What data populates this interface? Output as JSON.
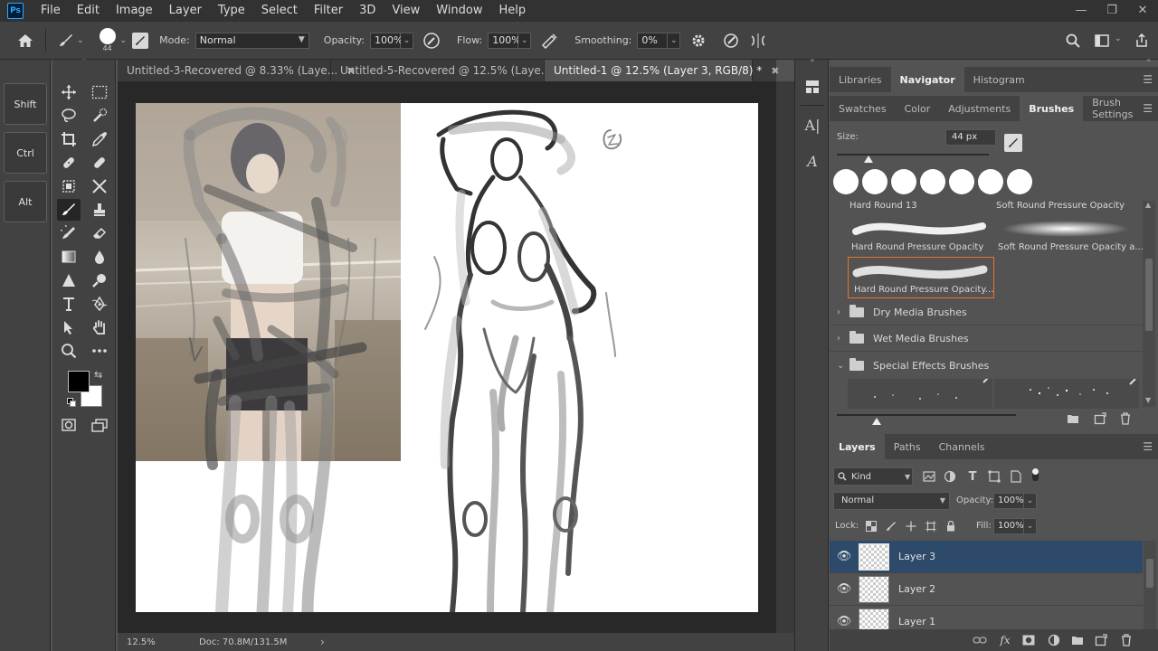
{
  "menu": {
    "logo": "Ps",
    "items": [
      "File",
      "Edit",
      "Image",
      "Layer",
      "Type",
      "Select",
      "Filter",
      "3D",
      "View",
      "Window",
      "Help"
    ]
  },
  "options": {
    "brush_size": "44",
    "mode_label": "Mode:",
    "mode_value": "Normal",
    "opacity_label": "Opacity:",
    "opacity_value": "100%",
    "flow_label": "Flow:",
    "flow_value": "100%",
    "smoothing_label": "Smoothing:",
    "smoothing_value": "0%"
  },
  "modifier_keys": [
    "Shift",
    "Ctrl",
    "Alt"
  ],
  "tabs": [
    {
      "label": "Untitled-3-Recovered @ 8.33% (Laye...",
      "active": false
    },
    {
      "label": "Untitled-5-Recovered @ 12.5% (Laye...",
      "active": false
    },
    {
      "label": "Untitled-1 @ 12.5% (Layer 3, RGB/8) *",
      "active": true
    }
  ],
  "status": {
    "zoom": "12.5%",
    "doc": "Doc: 70.8M/131.5M"
  },
  "panel_top_tabs": [
    "Libraries",
    "Navigator",
    "Histogram"
  ],
  "panel_mid_tabs": [
    "Swatches",
    "Color",
    "Adjustments",
    "Brushes",
    "Brush Settings"
  ],
  "brushes": {
    "size_label": "Size:",
    "size_value": "44 px",
    "presets": [
      {
        "name": "Hard Round 13"
      },
      {
        "name": "Soft Round Pressure Opacity"
      },
      {
        "name": "Hard Round Pressure Opacity"
      },
      {
        "name": "Soft Round Pressure Opacity a..."
      },
      {
        "name": "Hard Round Pressure Opacity..."
      }
    ],
    "folders": [
      "Dry Media Brushes",
      "Wet Media Brushes",
      "Special Effects Brushes"
    ]
  },
  "layers_tabs": [
    "Layers",
    "Paths",
    "Channels"
  ],
  "layers_panel": {
    "kind_label": "Kind",
    "blend_mode": "Normal",
    "opacity_label": "Opacity:",
    "opacity_value": "100%",
    "lock_label": "Lock:",
    "fill_label": "Fill:",
    "fill_value": "100%",
    "layers": [
      {
        "name": "Layer 3",
        "active": true
      },
      {
        "name": "Layer 2",
        "active": false
      },
      {
        "name": "Layer 1",
        "active": false
      }
    ]
  },
  "colors": {
    "accent_selected_layer": "#2e4a6b",
    "brush_selected_border": "#e8752a",
    "foreground": "#000000",
    "background": "#ffffff"
  }
}
